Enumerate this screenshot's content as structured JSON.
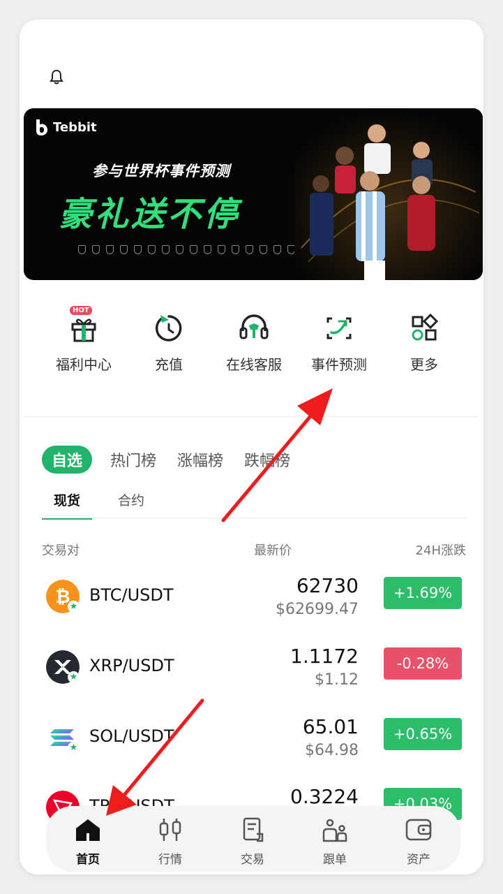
{
  "banner": {
    "brand": "Tebbit",
    "subtitle": "参与世界杯事件预测",
    "headline": "豪礼送不停"
  },
  "quick_actions": [
    {
      "label": "福利中心",
      "icon": "gift-icon",
      "badge": "HOT"
    },
    {
      "label": "充值",
      "icon": "recharge-icon"
    },
    {
      "label": "在线客服",
      "icon": "headset-icon"
    },
    {
      "label": "事件预测",
      "icon": "prediction-icon"
    },
    {
      "label": "更多",
      "icon": "grid-more-icon"
    }
  ],
  "market_tabs": [
    "自选",
    "热门榜",
    "涨幅榜",
    "跌幅榜"
  ],
  "sub_tabs": [
    "现货",
    "合约"
  ],
  "columns": {
    "pair": "交易对",
    "price": "最新价",
    "change": "24H涨跌"
  },
  "rows": [
    {
      "pair": "BTC/USDT",
      "price": "62730",
      "usd": "$62699.47",
      "change": "+1.69%",
      "direction": "up"
    },
    {
      "pair": "XRP/USDT",
      "price": "1.1172",
      "usd": "$1.12",
      "change": "-0.28%",
      "direction": "down"
    },
    {
      "pair": "SOL/USDT",
      "price": "65.01",
      "usd": "$64.98",
      "change": "+0.65%",
      "direction": "up"
    },
    {
      "pair": "TRX/USDT",
      "price": "0.3224",
      "usd": "",
      "change": "+0.03%",
      "direction": "up"
    }
  ],
  "bottom_nav": [
    {
      "label": "首页",
      "icon": "home-icon",
      "active": true
    },
    {
      "label": "行情",
      "icon": "candlestick-icon"
    },
    {
      "label": "交易",
      "icon": "trade-icon"
    },
    {
      "label": "跟单",
      "icon": "copy-trade-icon"
    },
    {
      "label": "资产",
      "icon": "wallet-icon"
    }
  ],
  "colors": {
    "accent": "#20b36a",
    "up": "#2bbd6a",
    "down": "#e9506a",
    "arrow": "#ee1c1c"
  }
}
